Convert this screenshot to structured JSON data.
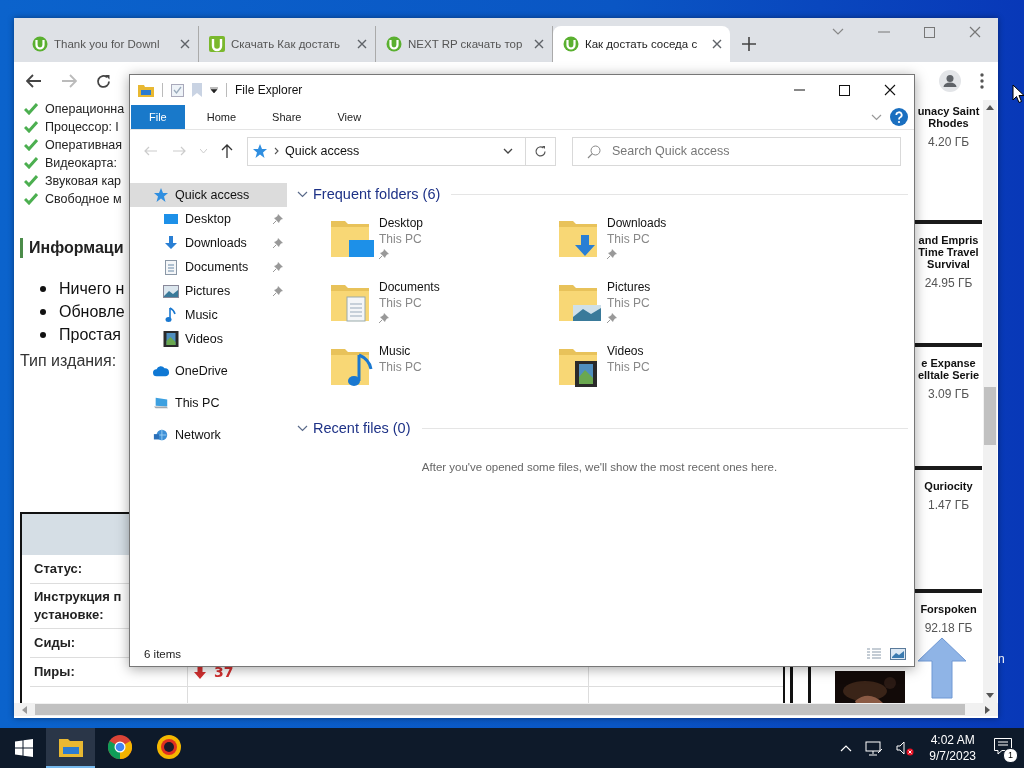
{
  "desktop": {
    "icon_label": "n"
  },
  "browser": {
    "tabs": [
      {
        "title": "Thank you for Downl",
        "kind": "utorrent",
        "selected": false
      },
      {
        "title": "Скачать Как достать",
        "kind": "u",
        "selected": false
      },
      {
        "title": "NEXT RP скачать тор",
        "kind": "utorrent",
        "selected": false
      },
      {
        "title": "Как достать соседа с",
        "kind": "utorrent",
        "selected": true
      }
    ]
  },
  "page": {
    "requirements": [
      "Операционна",
      "Процессор: I",
      "Оперативная",
      "Видеокарта:",
      "Звуковая кар",
      "Свободное м"
    ],
    "heading": "Информаци",
    "bullets": [
      "Ничего н",
      "Обновле",
      "Простая"
    ],
    "edition_label": "Тип издания:",
    "table": {
      "rows": [
        {
          "label": "Статус:"
        },
        {
          "label": "Инструкция п установке:"
        },
        {
          "label": "Сиды:"
        },
        {
          "label": "Пиры:",
          "value": "37",
          "decrease": true
        }
      ]
    },
    "games": [
      {
        "title": [
          "unacy Saint",
          "Rhodes"
        ],
        "size": "4.20 ГБ"
      },
      {
        "title": [
          "and Empris",
          "Time Travel",
          "Survival"
        ],
        "size": "24.95 ГБ"
      },
      {
        "title": [
          "e Expanse",
          "elltale Serie"
        ],
        "size": "3.09 ГБ"
      },
      {
        "title": [
          "Quriocity"
        ],
        "size": "1.47 ГБ"
      },
      {
        "title": [
          "Forspoken"
        ],
        "size": "92.18 ГБ"
      }
    ]
  },
  "explorer": {
    "title": "File Explorer",
    "ribbon": [
      {
        "label": "File",
        "kind": "menu"
      },
      {
        "label": "Home",
        "kind": "tab"
      },
      {
        "label": "Share",
        "kind": "tab"
      },
      {
        "label": "View",
        "kind": "tab"
      }
    ],
    "address": "Quick access",
    "search": {
      "placeholder": "Search Quick access"
    },
    "nav": [
      {
        "label": "Quick access",
        "kind": "star",
        "selected": true,
        "children": [
          {
            "label": "Desktop",
            "kind": "desktop",
            "pinned": true,
            "selected": false
          },
          {
            "label": "Downloads",
            "kind": "downloads",
            "pinned": true,
            "selected": false
          },
          {
            "label": "Documents",
            "kind": "documents",
            "pinned": true,
            "selected": false
          },
          {
            "label": "Pictures",
            "kind": "pictures",
            "pinned": true,
            "selected": false
          },
          {
            "label": "Music",
            "kind": "music",
            "pinned": false,
            "selected": false
          },
          {
            "label": "Videos",
            "kind": "videos",
            "pinned": false,
            "selected": false
          }
        ]
      },
      {
        "label": "OneDrive",
        "kind": "cloud",
        "selected": false
      },
      {
        "label": "This PC",
        "kind": "pc",
        "selected": false
      },
      {
        "label": "Network",
        "kind": "network",
        "selected": false
      }
    ],
    "sections": [
      {
        "title": "Frequent folders (6)",
        "expanded": true,
        "folders": [
          {
            "name": "Desktop",
            "location": "This PC",
            "kind": "desktop",
            "pinned": true
          },
          {
            "name": "Downloads",
            "location": "This PC",
            "kind": "downloads",
            "pinned": true
          },
          {
            "name": "Documents",
            "location": "This PC",
            "kind": "documents",
            "pinned": true
          },
          {
            "name": "Pictures",
            "location": "This PC",
            "kind": "pictures",
            "pinned": true
          },
          {
            "name": "Music",
            "location": "This PC",
            "kind": "music",
            "pinned": false
          },
          {
            "name": "Videos",
            "location": "This PC",
            "kind": "videos",
            "pinned": false
          }
        ]
      },
      {
        "title": "Recent files (0)",
        "expanded": true,
        "message": "After you've opened some files, we'll show the most recent ones here."
      }
    ],
    "status": "6 items"
  },
  "taskbar": {
    "apps": [
      {
        "kind": "explorer",
        "active": true
      },
      {
        "kind": "chrome",
        "active": false
      },
      {
        "kind": "ring",
        "active": false
      }
    ],
    "time": "4:02 AM",
    "date": "9/7/2023",
    "notifications": "1"
  }
}
